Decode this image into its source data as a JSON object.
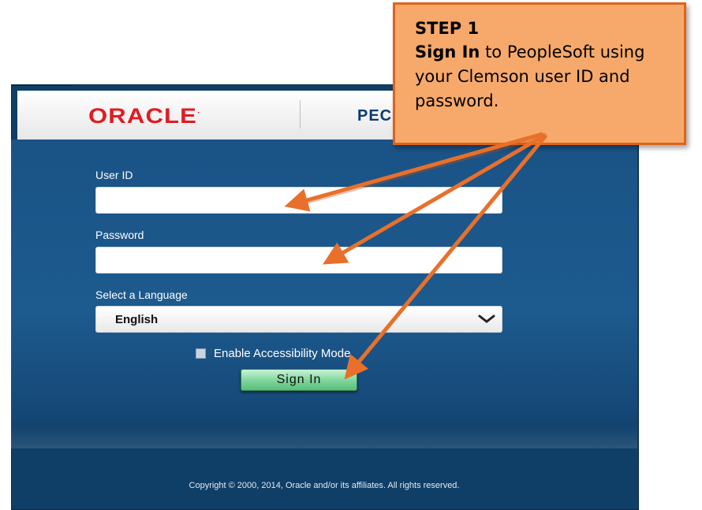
{
  "brand": {
    "oracle_logo": "ORACLE",
    "peoplesoft_logo": "PEC"
  },
  "form": {
    "user_id_label": "User ID",
    "user_id_value": "",
    "password_label": "Password",
    "password_value": "",
    "language_label": "Select a Language",
    "language_selected": "English",
    "accessibility_label": "Enable Accessibility Mode",
    "accessibility_checked": false,
    "sign_in_label": "Sign In"
  },
  "footer": {
    "copyright": "Copyright © 2000, 2014, Oracle and/or its affiliates. All rights reserved."
  },
  "callout": {
    "title": "STEP 1",
    "action": "Sign In",
    "text": " to PeopleSoft using your Clemson user ID and password."
  },
  "colors": {
    "panel_blue": "#1d5a8e",
    "oracle_red": "#e11b22",
    "callout_fill": "#f6a96a",
    "callout_border": "#e0631b",
    "arrow": "#e8702a",
    "sign_in_green": "#7dd49a"
  },
  "icons": {
    "language_dropdown": "chevron-down-icon",
    "accessibility_box": "checkbox-icon"
  }
}
